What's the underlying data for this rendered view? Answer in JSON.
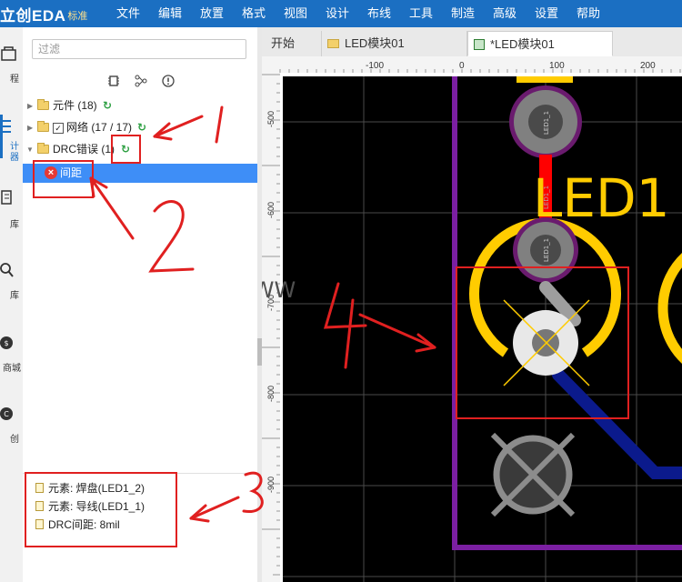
{
  "app": {
    "logo": "立创EDA",
    "edition": "标准"
  },
  "menu": [
    "文件",
    "编辑",
    "放置",
    "格式",
    "视图",
    "设计",
    "布线",
    "工具",
    "制造",
    "高级",
    "设置",
    "帮助"
  ],
  "rail": {
    "items": [
      {
        "label": "程",
        "icon": "project-icon"
      },
      {
        "label": "计器",
        "icon": "design-manager-icon"
      },
      {
        "label": "库",
        "icon": "library-icon"
      },
      {
        "label": "库",
        "icon": "search-library-icon"
      },
      {
        "label": "商城",
        "icon": "shop-icon"
      },
      {
        "label": "创",
        "icon": "community-icon"
      }
    ]
  },
  "panel": {
    "filter_placeholder": "过滤",
    "tool_icons": [
      "chip-icon",
      "network-icon",
      "info-icon"
    ],
    "tree": {
      "components": "元件 (18)",
      "nets": "网络 (17 / 17)",
      "drc": "DRC错误 (1)",
      "drc_item": "间距"
    },
    "details": [
      "元素: 焊盘(LED1_2)",
      "元素: 导线(LED1_1)",
      "DRC间距: 8mil"
    ]
  },
  "tabs": [
    {
      "label": "开始",
      "icon": ""
    },
    {
      "label": "LED模块01",
      "icon": "folder-icon"
    },
    {
      "label": "*LED模块01",
      "icon": "pcb-icon"
    }
  ],
  "ruler": {
    "x_ticks": [
      "-100",
      "0",
      "100",
      "200"
    ],
    "y_ticks": [
      "-500",
      "-600",
      "-700",
      "-800",
      "-900"
    ]
  },
  "canvas": {
    "designator": "LED1",
    "pad_labels": [
      "LED1_1",
      "LED1_1",
      "LED1_1"
    ],
    "watermark": "WWW"
  },
  "annotations": [
    "1",
    "2",
    "3",
    "4"
  ],
  "colors": {
    "menubar": "#1b6fc2",
    "board_bg": "#000000",
    "board_outline": "#7b1fa2",
    "silkscreen": "#ffcc00",
    "drc_track": "#ff0000",
    "bottom_track": "#0b1a8c",
    "annotation": "#e02020"
  }
}
